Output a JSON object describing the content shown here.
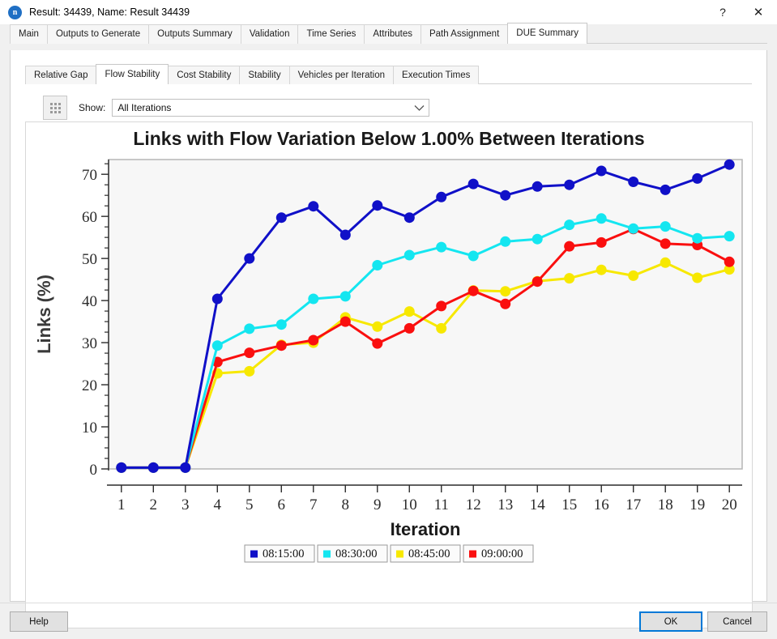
{
  "window": {
    "title": "Result: 34439, Name: Result 34439",
    "icon": "app-icon-n",
    "help_glyph": "?",
    "close_glyph": "✕"
  },
  "outer_tabs": [
    {
      "label": "Main",
      "active": false
    },
    {
      "label": "Outputs to Generate",
      "active": false
    },
    {
      "label": "Outputs Summary",
      "active": false
    },
    {
      "label": "Validation",
      "active": false
    },
    {
      "label": "Time Series",
      "active": false
    },
    {
      "label": "Attributes",
      "active": false
    },
    {
      "label": "Path Assignment",
      "active": false
    },
    {
      "label": "DUE Summary",
      "active": true
    }
  ],
  "inner_tabs": [
    {
      "label": "Relative Gap",
      "active": false
    },
    {
      "label": "Flow Stability",
      "active": true
    },
    {
      "label": "Cost Stability",
      "active": false
    },
    {
      "label": "Stability",
      "active": false
    },
    {
      "label": "Vehicles per Iteration",
      "active": false
    },
    {
      "label": "Execution Times",
      "active": false
    }
  ],
  "toolbar": {
    "grip_icon": "grip-dots-icon",
    "show_label": "Show:",
    "show_value": "All Iterations",
    "show_options": [
      "All Iterations"
    ],
    "dropdown_icon": "chevron-down-icon"
  },
  "footer": {
    "help_label": "Help",
    "ok_label": "OK",
    "cancel_label": "Cancel"
  },
  "chart_data": {
    "type": "line",
    "title": "Links with Flow Variation Below 1.00% Between Iterations",
    "xlabel": "Iteration",
    "ylabel": "Links (%)",
    "x": [
      1,
      2,
      3,
      4,
      5,
      6,
      7,
      8,
      9,
      10,
      11,
      12,
      13,
      14,
      15,
      16,
      17,
      18,
      19,
      20
    ],
    "xlim": [
      0.6,
      20.4
    ],
    "ylim": [
      -1.5,
      74
    ],
    "yticks": [
      0,
      10,
      20,
      30,
      40,
      50,
      60,
      70
    ],
    "xticks": [
      1,
      2,
      3,
      4,
      5,
      6,
      7,
      8,
      9,
      10,
      11,
      12,
      13,
      14,
      15,
      16,
      17,
      18,
      19,
      20
    ],
    "minor_tick_step": 2.5,
    "grid": false,
    "legend_position": "bottom",
    "plot_background": "#f7f7f7",
    "series": [
      {
        "name": "08:15:00",
        "color": "#1010c8",
        "values": [
          0.3,
          0.3,
          0.3,
          40.4,
          50.0,
          59.7,
          62.4,
          55.6,
          62.6,
          59.7,
          64.6,
          67.7,
          65.0,
          67.1,
          67.5,
          70.8,
          68.2,
          66.3,
          69.0,
          72.3
        ]
      },
      {
        "name": "08:30:00",
        "color": "#14e6f0",
        "values": [
          0.3,
          0.3,
          0.3,
          29.3,
          33.3,
          34.3,
          40.4,
          41.0,
          48.4,
          50.8,
          52.7,
          50.6,
          54.0,
          54.6,
          58.0,
          59.5,
          57.1,
          57.6,
          54.8,
          55.3
        ]
      },
      {
        "name": "08:45:00",
        "color": "#f7e800",
        "values": [
          0.3,
          0.3,
          0.3,
          22.7,
          23.2,
          29.5,
          30.0,
          36.0,
          33.8,
          37.4,
          33.4,
          42.4,
          42.2,
          44.6,
          45.3,
          47.3,
          45.9,
          49.0,
          45.4,
          47.4
        ]
      },
      {
        "name": "09:00:00",
        "color": "#fa0f0f",
        "values": [
          0.3,
          0.3,
          0.3,
          25.4,
          27.6,
          29.3,
          30.6,
          35.0,
          29.8,
          33.4,
          38.7,
          42.3,
          39.2,
          44.5,
          52.9,
          53.8,
          57.0,
          53.5,
          53.2,
          49.2
        ]
      }
    ]
  }
}
